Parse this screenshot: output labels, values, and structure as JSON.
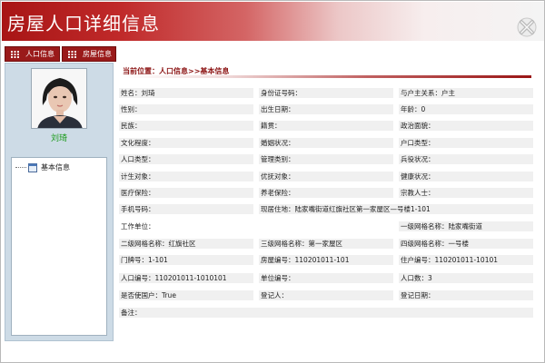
{
  "window": {
    "title": "房屋人口详细信息"
  },
  "tabs": [
    {
      "label": "人口信息"
    },
    {
      "label": "房屋信息"
    }
  ],
  "person": {
    "name": "刘琦"
  },
  "tree": {
    "items": [
      {
        "label": "基本信息"
      }
    ]
  },
  "breadcrumb": {
    "text": "当前位置：人口信息>>基本信息"
  },
  "fields": {
    "r1": [
      "姓名：刘琦",
      "身份证号码：",
      "与户主关系：户主"
    ],
    "r2": [
      "性别：",
      "出生日期：",
      "年龄：0"
    ],
    "r3": [
      "民族：",
      "籍贯：",
      "政治面貌："
    ],
    "r4": [
      "文化程度：",
      "婚姻状况：",
      "户口类型："
    ],
    "r5": [
      "人口类型：",
      "管理类别：",
      "兵役状况："
    ],
    "r6": [
      "计生对象：",
      "优抚对象：",
      "健康状况："
    ],
    "r7": [
      "医疗保险：",
      "养老保险：",
      "宗教人士："
    ],
    "r8": [
      "手机号码：",
      "现居住地：陆家嘴街道红旗社区第一家屋区—号楼1-101"
    ],
    "r9": [
      "工作单位：",
      "一级网格名称：陆家嘴街道"
    ],
    "r10": [
      "二级网格名称：红旗社区",
      "三级网格名称：第一家屋区",
      "四级网格名称：一号楼"
    ],
    "r11": [
      "门牌号：1-101",
      "房屋编号：110201011-101",
      "住户编号：110201011-10101"
    ],
    "r12": [
      "人口编号：110201011-1010101",
      "单位编号：",
      "人口数：3"
    ],
    "r13": [
      "是否使国户：True",
      "登记人：",
      "登记日期："
    ],
    "r14": [
      "备注："
    ]
  }
}
